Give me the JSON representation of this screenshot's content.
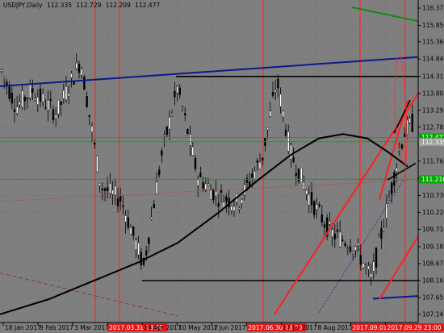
{
  "header": {
    "symbol": "USDJPY",
    "timeframe": "Daily",
    "open": "112.335",
    "high": "112.729",
    "low": "112.209",
    "close": "112.477"
  },
  "chart_data": {
    "type": "candlestick",
    "title": "USDJPY,Daily 112.335 112.729 112.209 112.477",
    "y_range": [
      107.145,
      116.375
    ],
    "y_ticks": [
      "116.375",
      "115.850",
      "115.360",
      "114.840",
      "114.315",
      "113.805",
      "113.295",
      "112.785",
      "112.270",
      "111.760",
      "111.250",
      "110.730",
      "110.220",
      "109.710",
      "109.185",
      "108.675",
      "108.165",
      "107.655",
      "107.145"
    ],
    "x_ticks": [
      "18 Jan 2017",
      "9 Feb 2017",
      "3 Mar 2017",
      "2017.03.31 23:00",
      "18 Apr 2017",
      "10 May 2017",
      "1 Jun 2017",
      "2017.06.30 23:00",
      "17 Jul 2017",
      "8 Aug 2017",
      "2017.09.01 23:00",
      "2017.09.29 23:00"
    ],
    "highlighted_x_ticks": [
      "2017.03.31 23:00",
      "2017.06.30 23:00",
      "2017.09.01 23:00",
      "2017.09.29 23:00"
    ],
    "price_labels": [
      {
        "value": "112.477",
        "color": "#00aa00"
      },
      {
        "value": "112.349",
        "color": "#00aa00"
      },
      {
        "value": "111.216",
        "color": "#00aa00"
      },
      {
        "value": "112.335",
        "color": "#a0a0a0"
      }
    ],
    "horizontal_levels": [
      112.477,
      112.349,
      111.216,
      114.315,
      108.165
    ],
    "grid": true,
    "colors": {
      "background": "#7f7f7f",
      "bull": "#ffffff",
      "bear": "#000000",
      "wick": "#000000",
      "vertical_markers": "#ff2a2a",
      "trendline_blue": "#0a1a8a",
      "level_green": "#1aa01a",
      "channel_red": "#ff2020",
      "moving_average": "#000000"
    }
  }
}
